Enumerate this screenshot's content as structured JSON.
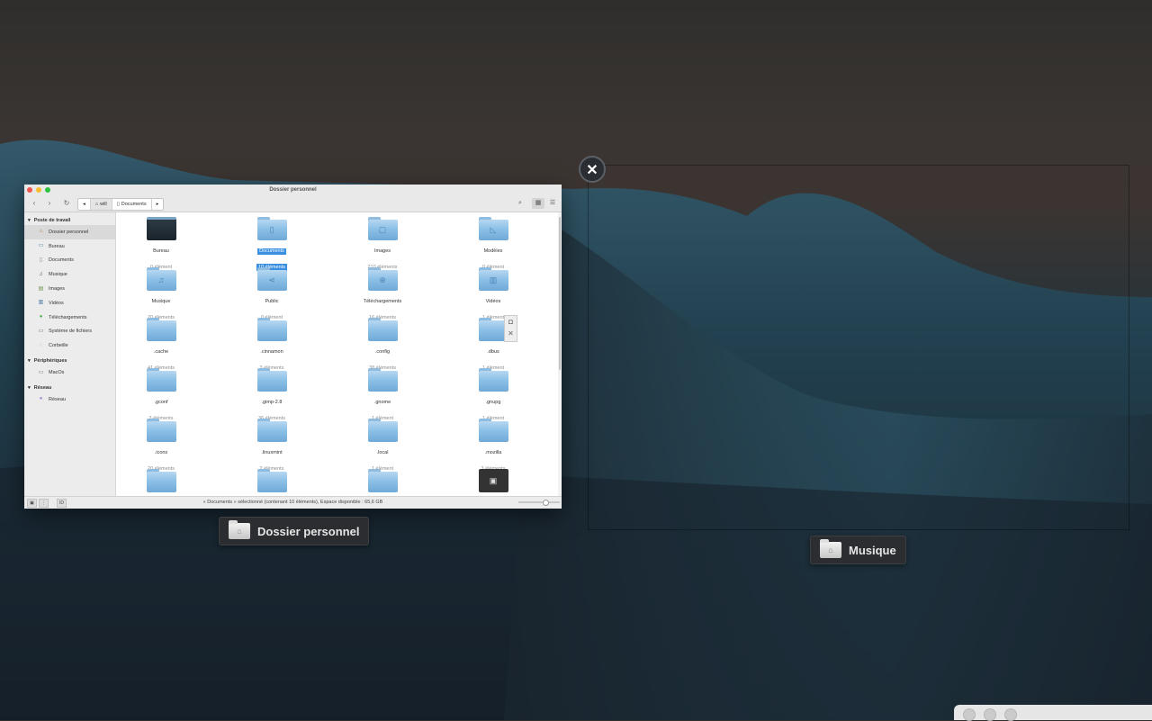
{
  "window": {
    "title": "Dossier personnel",
    "breadcrumbs": [
      "will",
      "Documents"
    ],
    "status": "« Documents » sélectionné (contenant 10 éléments), Espace disponible : 65,6 GB",
    "status_buttons": [
      "ID"
    ]
  },
  "sidebar": {
    "sections": [
      {
        "label": "Poste de travail",
        "items": [
          {
            "label": "Dossier personnel",
            "icon": "home-icon",
            "selected": true
          },
          {
            "label": "Bureau",
            "icon": "desktop-icon"
          },
          {
            "label": "Documents",
            "icon": "document-icon"
          },
          {
            "label": "Musique",
            "icon": "music-icon"
          },
          {
            "label": "Images",
            "icon": "image-icon"
          },
          {
            "label": "Vidéos",
            "icon": "video-icon"
          },
          {
            "label": "Téléchargements",
            "icon": "download-icon"
          },
          {
            "label": "Système de fichiers",
            "icon": "drive-icon"
          },
          {
            "label": "Corbeille",
            "icon": "trash-icon"
          }
        ]
      },
      {
        "label": "Périphériques",
        "items": [
          {
            "label": "MacOs",
            "icon": "drive-icon"
          }
        ]
      },
      {
        "label": "Réseau",
        "items": [
          {
            "label": "Réseau",
            "icon": "network-icon"
          }
        ]
      }
    ]
  },
  "files": [
    {
      "name": "Bureau",
      "count": "0 élément",
      "glyph": "desktop"
    },
    {
      "name": "Documents",
      "count": "10 éléments",
      "glyph": "doc",
      "selected": true
    },
    {
      "name": "Images",
      "count": "210 éléments",
      "glyph": "img"
    },
    {
      "name": "Modèles",
      "count": "0 élément",
      "glyph": "tpl"
    },
    {
      "name": "Musique",
      "count": "70 éléments",
      "glyph": "music"
    },
    {
      "name": "Public",
      "count": "0 élément",
      "glyph": "share"
    },
    {
      "name": "Téléchargements",
      "count": "16 éléments",
      "glyph": "dl"
    },
    {
      "name": "Vidéos",
      "count": "1 élément",
      "glyph": "video"
    },
    {
      "name": ".cache",
      "count": "41 éléments",
      "glyph": ""
    },
    {
      "name": ".cinnamon",
      "count": "3 éléments",
      "glyph": ""
    },
    {
      "name": ".config",
      "count": "38 éléments",
      "glyph": ""
    },
    {
      "name": ".dbus",
      "count": "1 élément",
      "glyph": "lock"
    },
    {
      "name": ".gconf",
      "count": "3 éléments",
      "glyph": ""
    },
    {
      "name": ".gimp-2.8",
      "count": "36 éléments",
      "glyph": ""
    },
    {
      "name": ".gnome",
      "count": "1 élément",
      "glyph": ""
    },
    {
      "name": ".gnupg",
      "count": "1 élément",
      "glyph": ""
    },
    {
      "name": ".icons",
      "count": "20 éléments",
      "glyph": ""
    },
    {
      "name": ".linuxmint",
      "count": "2 éléments",
      "glyph": ""
    },
    {
      "name": ".local",
      "count": "1 élément",
      "glyph": ""
    },
    {
      "name": ".mozilla",
      "count": "3 éléments",
      "glyph": ""
    },
    {
      "name": "",
      "count": "",
      "glyph": ""
    },
    {
      "name": "",
      "count": "",
      "glyph": ""
    },
    {
      "name": "",
      "count": "",
      "glyph": ""
    },
    {
      "name": "",
      "count": "",
      "glyph": "film"
    }
  ],
  "workspace": {
    "label_left": "Dossier personnel",
    "label_right": "Musique",
    "close_glyph": "✕"
  },
  "colors": {
    "accent": "#3b8fe0",
    "folder": "#8cc0e6"
  }
}
